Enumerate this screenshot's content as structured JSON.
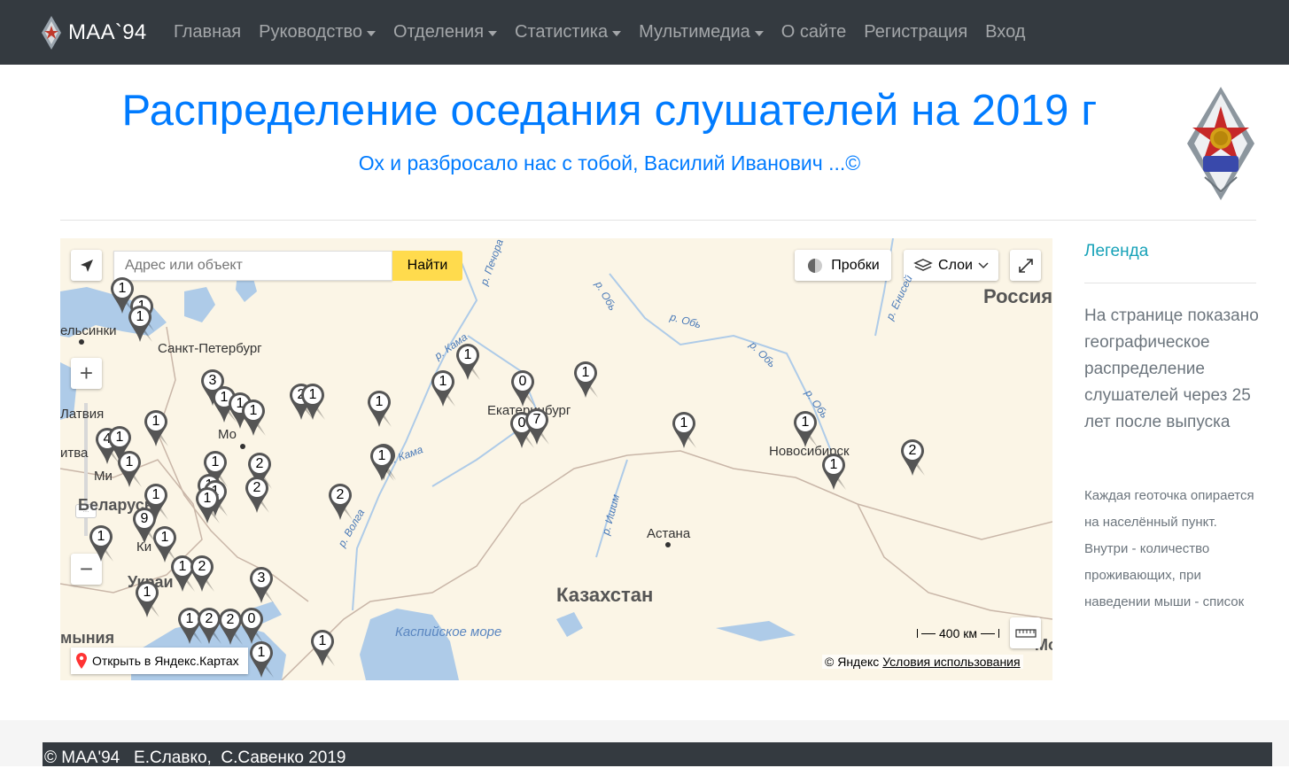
{
  "navbar": {
    "brand": "МАА`94",
    "items": [
      {
        "label": "Главная",
        "dropdown": false
      },
      {
        "label": "Руководство",
        "dropdown": true
      },
      {
        "label": "Отделения",
        "dropdown": true
      },
      {
        "label": "Статистика",
        "dropdown": true
      },
      {
        "label": "Мультимедиа",
        "dropdown": true
      },
      {
        "label": "О сайте",
        "dropdown": false
      },
      {
        "label": "Регистрация",
        "dropdown": false
      },
      {
        "label": "Вход",
        "dropdown": false
      }
    ]
  },
  "header": {
    "title": "Распределение оседания слушателей на 2019 г",
    "subtitle": "Ох и разбросало нас с тобой, Василий Иванович ...©"
  },
  "map": {
    "search_placeholder": "Адрес или объект",
    "search_button": "Найти",
    "traffic_button": "Пробки",
    "layers_button": "Слои",
    "open_link": "Открыть в Яндекс.Картах",
    "scale": "400 км",
    "copyright": "© Яндекс",
    "terms": "Условия использования",
    "places": {
      "helsinki": "ельсинки",
      "spb": "Санкт-Петербург",
      "latvia": "Латвия",
      "litva": "итва",
      "minsk": "Ми",
      "belarus": "Беларусь",
      "moscow": "Мо",
      "kiev": "Ки",
      "ukraine": "Украи",
      "romania": "мыния",
      "ekb": "Екатеринбург",
      "novosibirsk": "Новосибирск",
      "astana": "Астана",
      "kazakhstan": "Казахстан",
      "russia": "Россия",
      "mo": "Мо",
      "caspian": "Каспийское море",
      "river_pechora": "р. Печора",
      "river_ob1": "р. Обь",
      "river_ob2": "р. Обь",
      "river_ob3": "р. Обь",
      "river_ob4": "р. Обь",
      "river_enisey": "р. Енисей",
      "river_kama1": "р. Кама",
      "river_kama2": "р. Кама",
      "river_volga": "р. Волга",
      "river_ishim": "р. Ишим"
    },
    "markers": [
      "1",
      "1",
      "1",
      "3",
      "1",
      "1",
      "1",
      "2",
      "1",
      "1",
      "1",
      "1",
      "0",
      "0",
      "7",
      "1",
      "1",
      "1",
      "1",
      "2",
      "2",
      "1",
      "1",
      "4",
      "1",
      "1",
      "1",
      "2",
      "1",
      "2",
      "9",
      "1",
      "1",
      "1",
      "1",
      "2",
      "3",
      "1",
      "1",
      "2",
      "2",
      "0",
      "1",
      "1",
      "1",
      "2",
      "1"
    ],
    "colors": {
      "marker": "#555555",
      "water": "#aecbe8",
      "land": "#fbf5e6"
    }
  },
  "sidebar": {
    "legend_title": "Легенда",
    "lead": "На странице показано географическое распределение слушателей через 25 лет после выпуска",
    "details": "Каждая геоточка опирается на населённый пункт. Внутри - количество проживающих, при наведении мыши - список"
  },
  "footer": {
    "text": "© МАА'94   Е.Славко,  С.Савенко 2019"
  }
}
